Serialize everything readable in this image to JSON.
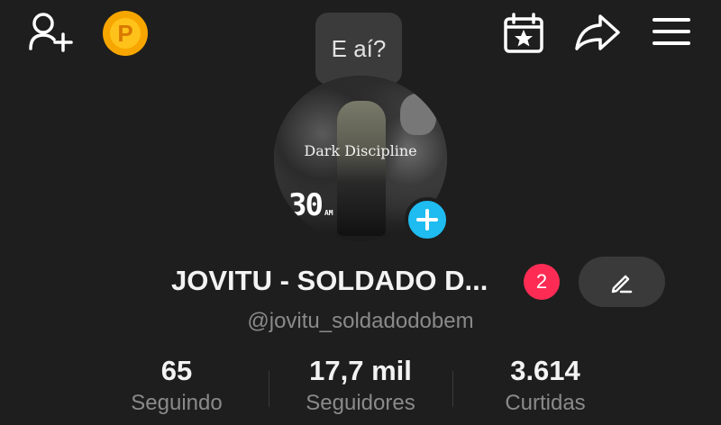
{
  "header": {
    "coin_letter": "P"
  },
  "bubble": {
    "text": "E aí?"
  },
  "avatar": {
    "overlay_text": "Dark Discipline",
    "clock_text": "30",
    "clock_suffix": "AM"
  },
  "profile": {
    "name": "JOVITU - SOLDADO D...",
    "badge_count": "2",
    "handle": "@jovitu_soldadodobem"
  },
  "stats": [
    {
      "value": "65",
      "label": "Seguindo"
    },
    {
      "value": "17,7 mil",
      "label": "Seguidores"
    },
    {
      "value": "3.614",
      "label": "Curtidas"
    }
  ],
  "colors": {
    "background": "#1e1e1e",
    "accent_blue": "#1ebcf0",
    "badge_red": "#fe2c55",
    "coin_gold": "#ffc21a"
  }
}
